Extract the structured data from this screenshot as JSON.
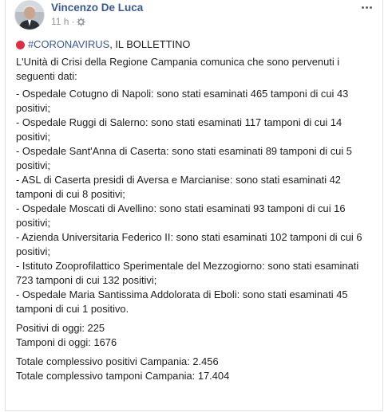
{
  "post": {
    "author": "Vincenzo De Luca",
    "time": "11 h",
    "sep": "·",
    "audience_icon": "gear-icon",
    "more_icon": "more-options-icon"
  },
  "content": {
    "hashtag": "#CORONAVIRUS",
    "title_rest": ", IL BOLLETTINO",
    "intro": "L'Unità di Crisi della Regione Campania comunica che sono pervenuti i seguenti dati:",
    "items": [
      "- Ospedale Cotugno di Napoli: sono stati esaminati 465 tamponi di cui 43 positivi;",
      "- Ospedale Ruggi di Salerno: sono stati esaminati 117 tamponi di cui 14 positivi;",
      "- Ospedale Sant'Anna di Caserta: sono stati esaminati 89 tamponi di cui 5 positivi;",
      "- ASL di Caserta presidi di Aversa e Marcianise: sono stati esaminati 42 tamponi di cui 8 positivi;",
      "- Ospedale Moscati di Avellino: sono stati esaminati 93 tamponi di cui 16 positivi;",
      "- Azienda Universitaria Federico II: sono stati esaminati 102 tamponi di cui 6 positivi;",
      "- Istituto Zooprofilattico Sperimentale del Mezzogiorno: sono stati esaminati 723 tamponi di cui 132 positivi;",
      "- Ospedale Maria Santissima Addolorata di Eboli: sono stati esaminati 45 tamponi di cui 1 positivo."
    ],
    "positivi_oggi": "Positivi di oggi: 225",
    "tamponi_oggi": "Tamponi di oggi: 1676",
    "totale_positivi": "Totale complessivo positivi Campania: 2.456",
    "totale_tamponi": "Totale complessivo tamponi Campania: 17.404"
  },
  "colors": {
    "link": "#385898",
    "text": "#1c1e21",
    "meta": "#90949c",
    "red_dot": "#dd2e44"
  }
}
